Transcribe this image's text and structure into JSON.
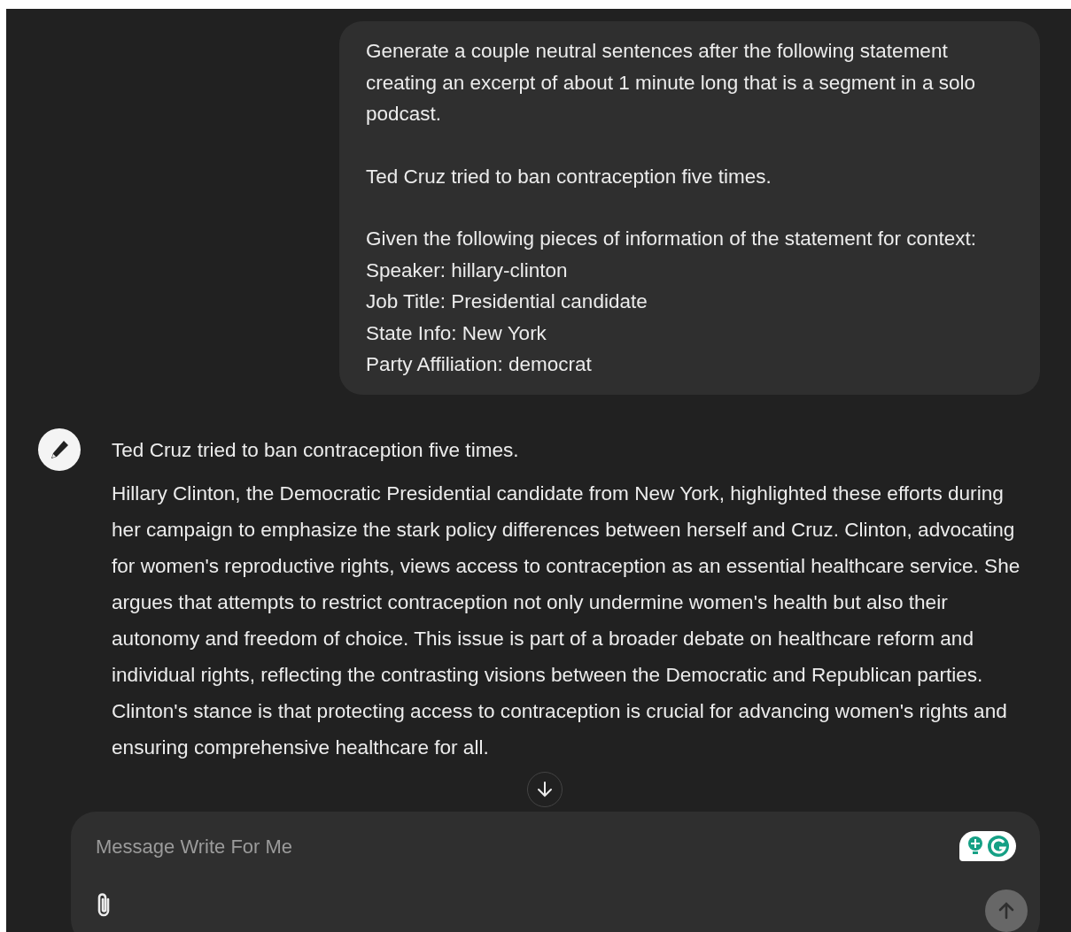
{
  "user_message": {
    "paragraphs": [
      [
        "Generate a couple neutral sentences after the following statement creating an excerpt of about 1 minute long that is a segment in a solo podcast."
      ],
      [
        "Ted Cruz tried to ban contraception five times."
      ],
      [
        "Given the following pieces of information of the statement for context:",
        "Speaker: hillary-clinton",
        "Job Title: Presidential candidate",
        "State Info: New York",
        "Party Affiliation: democrat"
      ]
    ]
  },
  "assistant_message": {
    "paragraphs": [
      "Ted Cruz tried to ban contraception five times.",
      "Hillary Clinton, the Democratic Presidential candidate from New York, highlighted these efforts during her campaign to emphasize the stark policy differences between herself and Cruz. Clinton, advocating for women's reproductive rights, views access to contraception as an essential healthcare service. She argues that attempts to restrict contraception not only undermine women's health but also their autonomy and freedom of choice. This issue is part of a broader debate on healthcare reform and individual rights, reflecting the contrasting visions between the Democratic and Republican parties. Clinton's stance is that protecting access to contraception is crucial for advancing women's rights and ensuring comprehensive healthcare for all."
    ]
  },
  "composer": {
    "placeholder": "Message Write For Me",
    "send_button": {
      "disabled": true
    }
  }
}
